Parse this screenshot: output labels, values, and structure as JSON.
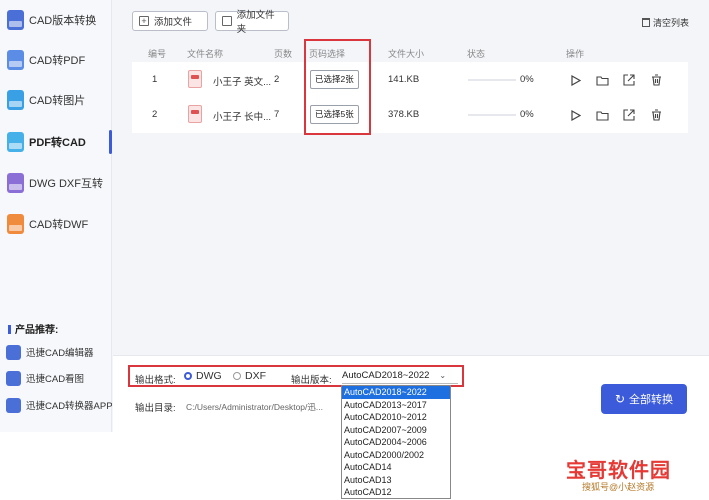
{
  "sidebar": {
    "items": [
      {
        "label": "CAD版本转换",
        "color": "#4a6fd6",
        "active": false
      },
      {
        "label": "CAD转PDF",
        "color": "#5b8de6",
        "active": false
      },
      {
        "label": "CAD转图片",
        "color": "#3aa0e6",
        "active": false
      },
      {
        "label": "PDF转CAD",
        "color": "#46b0e8",
        "active": true
      },
      {
        "label": "DWG DXF互转",
        "color": "#8b6fd6",
        "active": false
      },
      {
        "label": "CAD转DWF",
        "color": "#f08a3c",
        "active": false
      }
    ],
    "recommend_title": "产品推荐:",
    "recommend": [
      {
        "label": "迅捷CAD编辑器"
      },
      {
        "label": "迅捷CAD看图"
      },
      {
        "label": "迅捷CAD转换器APP"
      }
    ]
  },
  "toolbar": {
    "add_file": "添加文件",
    "add_folder": "添加文件夹",
    "clear_list": "清空列表"
  },
  "table": {
    "headers": {
      "index": "编号",
      "name": "文件名称",
      "pages": "页数",
      "page_select": "页码选择",
      "size": "文件大小",
      "status": "状态",
      "ops": "操作"
    },
    "rows": [
      {
        "index": "1",
        "name": "小王子 英文...",
        "pages": "2",
        "page_select": "已选择2张",
        "size": "141.KB",
        "progress": "0%"
      },
      {
        "index": "2",
        "name": "小王子 长中...",
        "pages": "7",
        "page_select": "已选择5张",
        "size": "378.KB",
        "progress": "0%"
      }
    ]
  },
  "bottom": {
    "format_label": "输出格式:",
    "format_dwg": "DWG",
    "format_dxf": "DXF",
    "version_label": "输出版本:",
    "version_value": "AutoCAD2018~2022",
    "dir_label": "输出目录:",
    "dir_value": "C:/Users/Administrator/Desktop/迅...",
    "convert_all": "全部转换"
  },
  "version_options": [
    "AutoCAD2018~2022",
    "AutoCAD2013~2017",
    "AutoCAD2010~2012",
    "AutoCAD2007~2009",
    "AutoCAD2004~2006",
    "AutoCAD2000/2002",
    "AutoCAD14",
    "AutoCAD13",
    "AutoCAD12"
  ],
  "watermark": {
    "line1": "宝哥软件园",
    "line2": "搜狐号@小赵资源"
  },
  "colors": {
    "accent": "#3b5bdb",
    "highlight": "#d9363e",
    "selected_option": "#1e6fe0"
  }
}
